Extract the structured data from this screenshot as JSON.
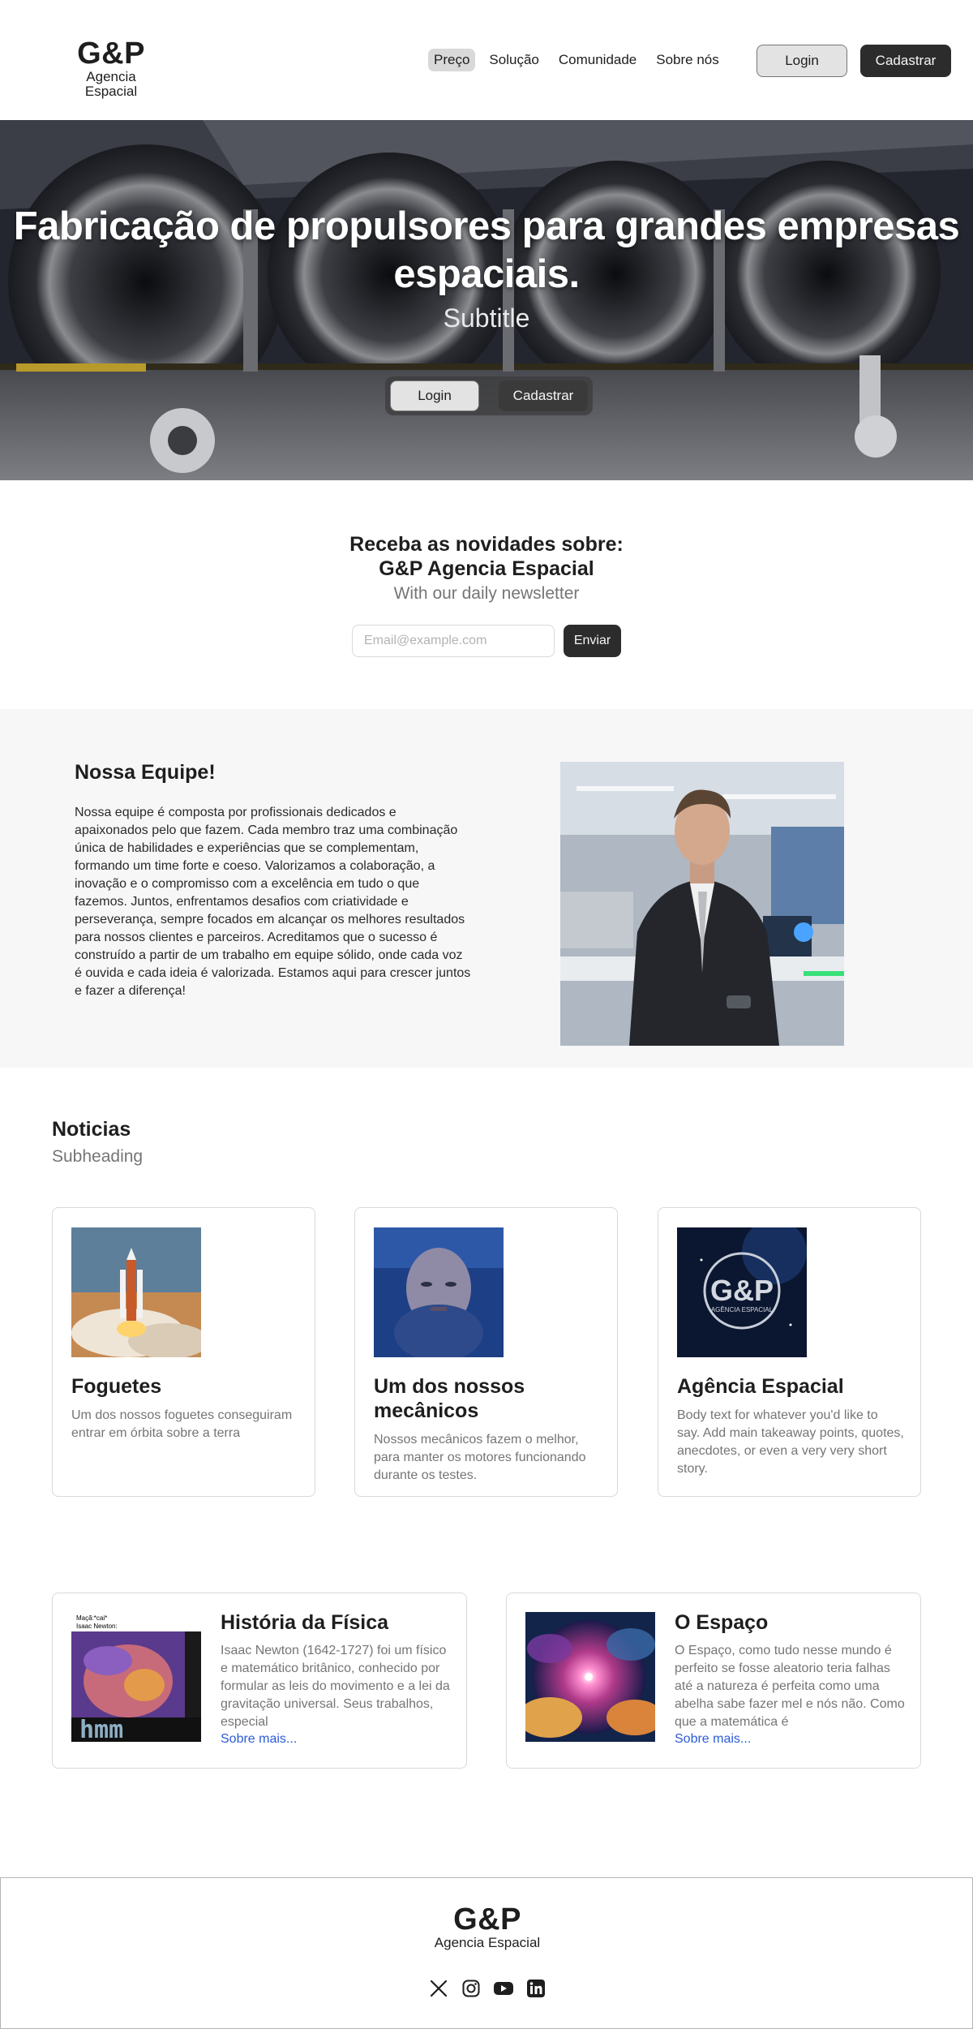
{
  "header": {
    "logo_mark": "G&P",
    "logo_sub": "Agencia Espacial",
    "nav": [
      {
        "label": "Preço"
      },
      {
        "label": "Solução"
      },
      {
        "label": "Comunidade"
      },
      {
        "label": "Sobre nós"
      }
    ],
    "login_label": "Login",
    "signup_label": "Cadastrar"
  },
  "hero": {
    "title": "Fabricação de propulsores para grandes empresas espaciais.",
    "subtitle": "Subtitle",
    "login_label": "Login",
    "signup_label": "Cadastrar"
  },
  "newsletter": {
    "title_line1": "Receba as novidades sobre:",
    "title_line2": "G&P Agencia Espacial",
    "subtitle": "With our daily newsletter",
    "placeholder": "Email@example.com",
    "button_label": "Enviar"
  },
  "team": {
    "title": "Nossa Equipe!",
    "body": "Nossa equipe é composta por profissionais dedicados e apaixonados pelo que fazem. Cada membro traz uma combinação única de habilidades e experiências que se complementam, formando um time forte e coeso. Valorizamos a colaboração, a inovação e o compromisso com a excelência em tudo o que fazemos. Juntos, enfrentamos desafios com criatividade e perseverança, sempre focados em alcançar os melhores resultados para nossos clientes e parceiros. Acreditamos que o sucesso é construído a partir de um trabalho em equipe sólido, onde cada voz é ouvida e cada ideia é valorizada. Estamos aqui para crescer juntos e fazer a diferença!"
  },
  "news": {
    "title": "Noticias",
    "subheading": "Subheading",
    "cards": [
      {
        "title": "Foguetes",
        "body": "Um dos nossos foguetes conseguiram entrar em órbita sobre a terra"
      },
      {
        "title": "Um dos nossos mecânicos",
        "body": "Nossos mecânicos fazem o melhor, para manter os motores funcionando durante os testes."
      },
      {
        "title": "Agência Espacial",
        "body": "Body text for whatever you'd like to say. Add main takeaway points, quotes, anecdotes, or even a very very short story.",
        "image_mark": "G&P",
        "image_sub": "AGÊNCIA ESPACIAL"
      }
    ],
    "articles": [
      {
        "title": "História da Física",
        "body": "Isaac Newton (1642-1727) foi um físico e matemático britânico, conhecido por formular as leis do movimento e a lei da gravitação universal. Seus trabalhos, especial",
        "link": "Sobre mais...",
        "image_caption1": "Maçã:*cai*",
        "image_caption2": "Isaac Newton:",
        "image_word": "hmm"
      },
      {
        "title": "O Espaço",
        "body": "O Espaço, como tudo nesse mundo é perfeito se fosse aleatorio teria falhas até a natureza é perfeita como uma abelha sabe fazer mel e nós não. Como que a matemática é",
        "link": "Sobre mais..."
      }
    ]
  },
  "footer": {
    "logo_mark": "G&P",
    "logo_sub": "Agencia Espacial",
    "socials": [
      "x-icon",
      "instagram-icon",
      "youtube-icon",
      "linkedin-icon"
    ]
  }
}
